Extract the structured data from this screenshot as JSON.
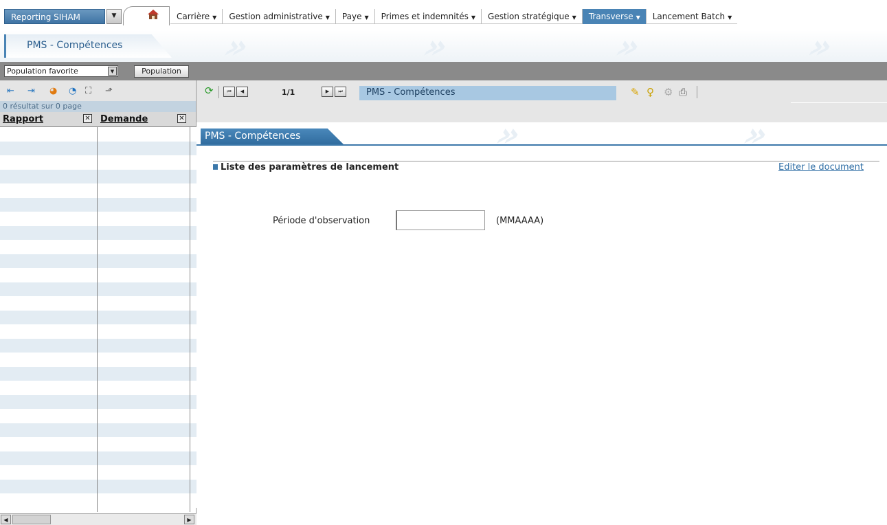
{
  "topbar": {
    "app_button": "Reporting SIHAM",
    "home_icon": "home-icon",
    "menu": [
      {
        "label": "Carrière",
        "active": false
      },
      {
        "label": "Gestion administrative",
        "active": false
      },
      {
        "label": "Paye",
        "active": false
      },
      {
        "label": "Primes et indemnités",
        "active": false
      },
      {
        "label": "Gestion stratégique",
        "active": false
      },
      {
        "label": "Transverse",
        "active": true
      },
      {
        "label": "Lancement Batch",
        "active": false
      }
    ]
  },
  "title_tab": "PMS - Compétences",
  "population": {
    "select_value": "Population favorite",
    "button_label": "Population"
  },
  "left_panel": {
    "result_text": "0 résultat sur 0 page",
    "columns": [
      "Rapport",
      "Demande"
    ]
  },
  "nav": {
    "pages": "1/1",
    "doc_title": "PMS - Compétences"
  },
  "doc_tab": "PMS - Compétences",
  "content": {
    "section_title": "Liste des paramètres de lancement",
    "edit_link": "Editer le document",
    "period_label": "Période d'observation",
    "period_value": "",
    "period_hint": "(MMAAAA)"
  },
  "colors": {
    "accent": "#4a84b5",
    "active_menu": "#4a84b5",
    "doc_title_bg": "#a8c8e2",
    "grid_alt_row": "#e3ecf3"
  }
}
